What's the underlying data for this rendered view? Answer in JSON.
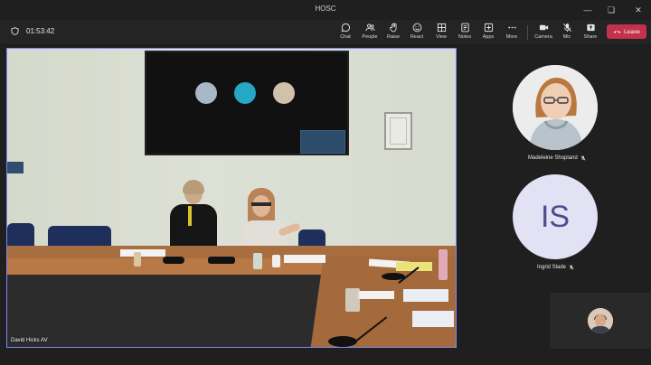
{
  "window": {
    "title": "HOSC"
  },
  "meeting": {
    "elapsed": "01:53:42"
  },
  "toolbar": {
    "chat": "Chat",
    "people": "People",
    "raise": "Raise",
    "react": "React",
    "view": "View",
    "notes": "Notes",
    "apps": "Apps",
    "more": "More",
    "camera": "Camera",
    "mic": "Mic",
    "share": "Share",
    "leave": "Leave"
  },
  "main_video": {
    "name": "David Hicks AV"
  },
  "participants": [
    {
      "name": "Madeleine Shopland",
      "type": "photo",
      "muted": true
    },
    {
      "name": "Ingrid Slade",
      "initials": "IS",
      "type": "initials",
      "muted": true
    }
  ],
  "colors": {
    "accent": "#7f85f5",
    "leave": "#c4314b",
    "initials_bg": "#e3e2f5",
    "initials_fg": "#4f4b8c"
  }
}
